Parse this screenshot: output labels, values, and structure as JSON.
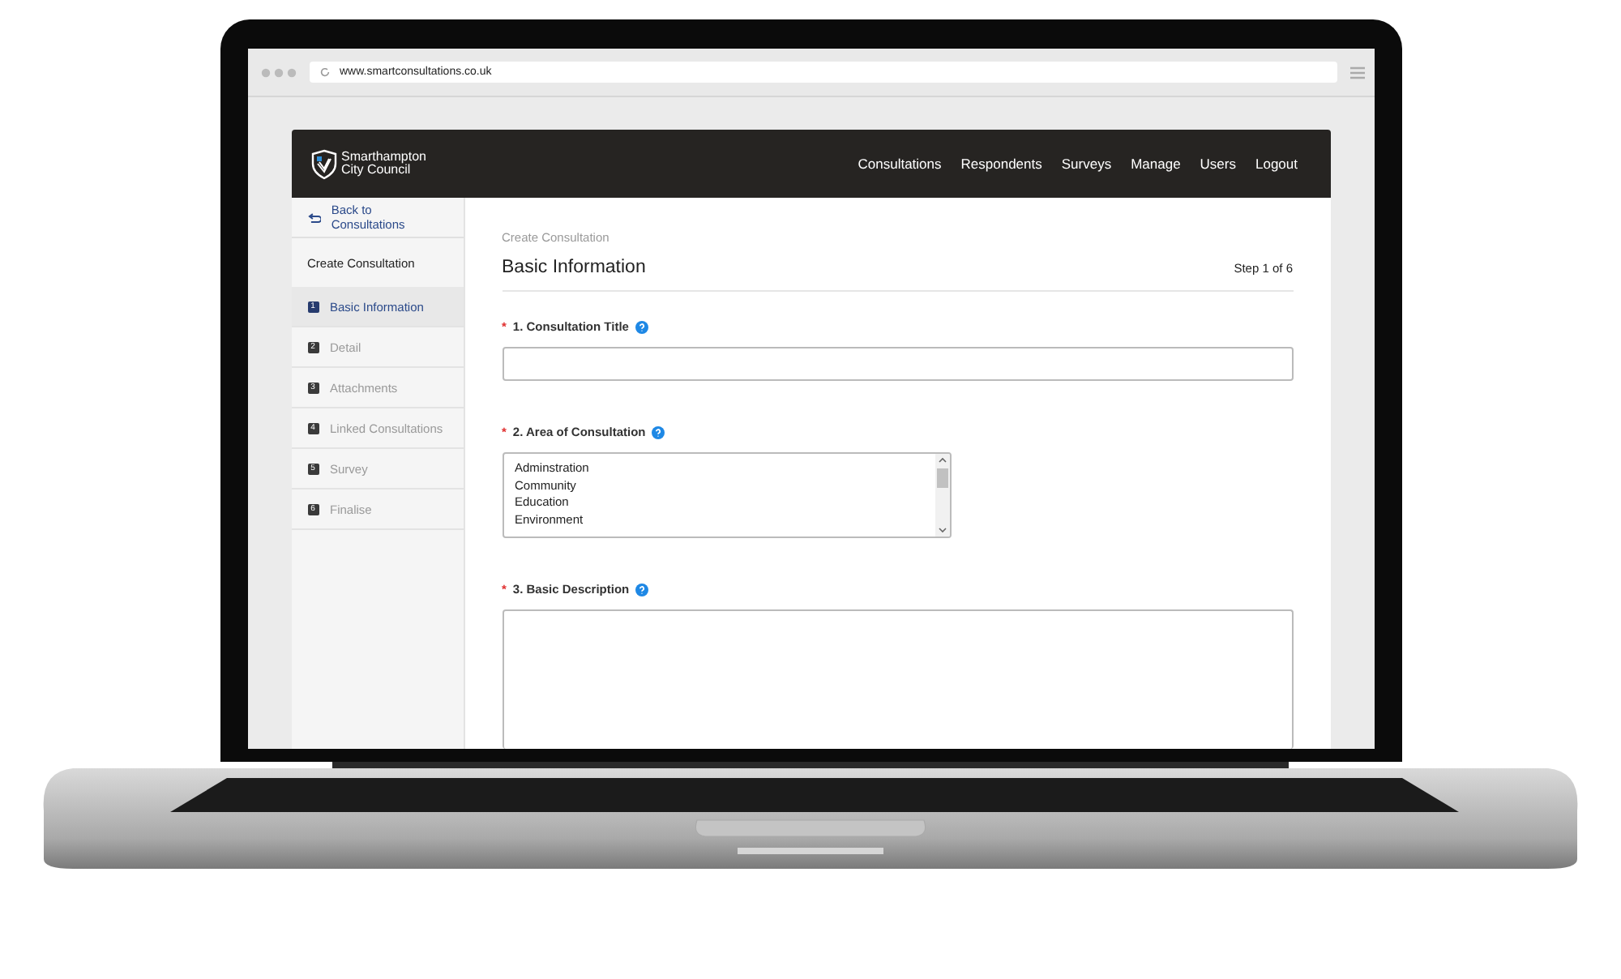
{
  "browser": {
    "url": "www.smartconsultations.co.uk"
  },
  "header": {
    "logo_lines": [
      "Smarthampton",
      "City Council"
    ],
    "nav": [
      "Consultations",
      "Respondents",
      "Surveys",
      "Manage",
      "Users",
      "Logout"
    ]
  },
  "sidebar": {
    "back_link": "Back to Consultations",
    "section_title": "Create Consultation",
    "steps": [
      {
        "number": "1",
        "label": "Basic Information",
        "selected": true
      },
      {
        "number": "2",
        "label": "Detail",
        "selected": false
      },
      {
        "number": "3",
        "label": "Attachments",
        "selected": false
      },
      {
        "number": "4",
        "label": "Linked Consultations",
        "selected": false
      },
      {
        "number": "5",
        "label": "Survey",
        "selected": false
      },
      {
        "number": "6",
        "label": "Finalise",
        "selected": false
      }
    ]
  },
  "form": {
    "breadcrumb": "Create Consultation",
    "title": "Basic Information",
    "step": "Step 1 of 6",
    "fields": [
      {
        "kind": "text",
        "marker": "*",
        "label": "1. Consultation Title"
      },
      {
        "kind": "list",
        "marker": "*",
        "label": "2. Area of Consultation",
        "options": [
          "Adminstration",
          "Community",
          "Education",
          "Environment"
        ]
      },
      {
        "kind": "textarea",
        "marker": "*",
        "label": "3. Basic Description"
      }
    ]
  }
}
